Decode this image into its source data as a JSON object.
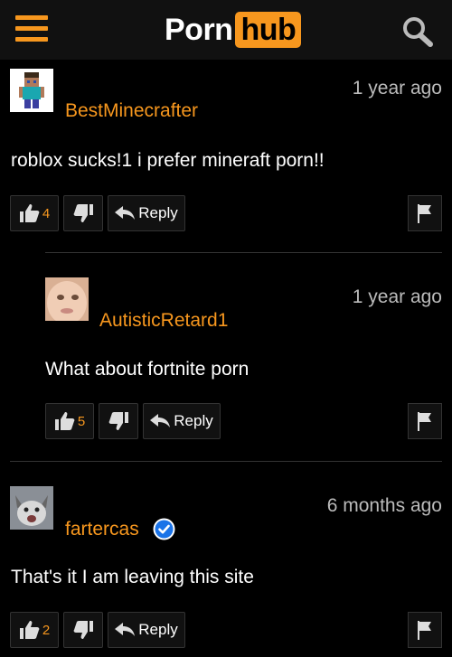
{
  "header": {
    "logo_left": "Porn",
    "logo_right": "hub"
  },
  "comments": [
    {
      "username": "BestMinecrafter",
      "timestamp": "1 year ago",
      "text": "roblox sucks!1 i prefer mineraft porn!!",
      "likes": "4",
      "reply_label": "Reply"
    },
    {
      "username": "AutisticRetard1",
      "timestamp": "1 year ago",
      "text": "What about fortnite porn",
      "likes": "5",
      "reply_label": "Reply"
    },
    {
      "username": "fartercas",
      "timestamp": "6 months ago",
      "text": "That's it I am leaving this site",
      "likes": "2",
      "reply_label": "Reply"
    }
  ],
  "colors": {
    "accent": "#f7971e",
    "background": "#000000",
    "verified": "#1a73e8"
  }
}
